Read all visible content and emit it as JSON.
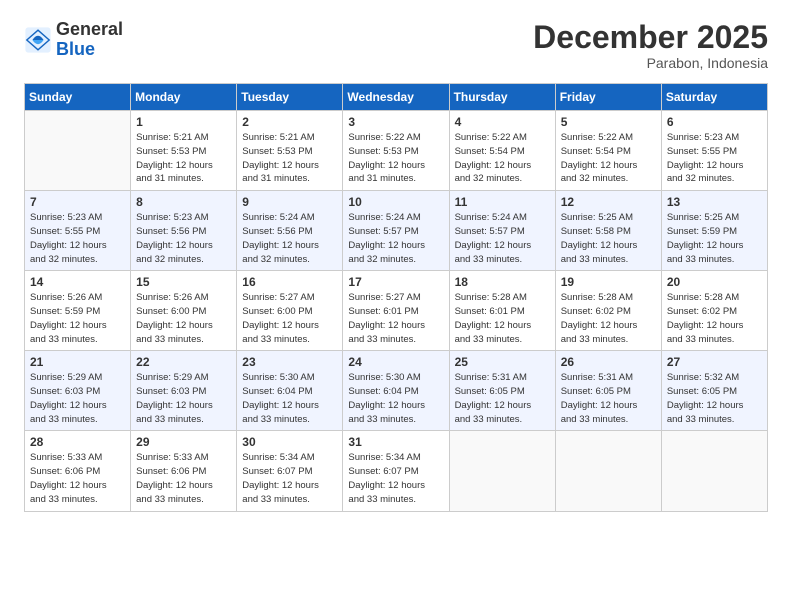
{
  "logo": {
    "general": "General",
    "blue": "Blue"
  },
  "title": "December 2025",
  "location": "Parabon, Indonesia",
  "weekdays": [
    "Sunday",
    "Monday",
    "Tuesday",
    "Wednesday",
    "Thursday",
    "Friday",
    "Saturday"
  ],
  "weeks": [
    [
      {
        "day": "",
        "info": ""
      },
      {
        "day": "1",
        "info": "Sunrise: 5:21 AM\nSunset: 5:53 PM\nDaylight: 12 hours\nand 31 minutes."
      },
      {
        "day": "2",
        "info": "Sunrise: 5:21 AM\nSunset: 5:53 PM\nDaylight: 12 hours\nand 31 minutes."
      },
      {
        "day": "3",
        "info": "Sunrise: 5:22 AM\nSunset: 5:53 PM\nDaylight: 12 hours\nand 31 minutes."
      },
      {
        "day": "4",
        "info": "Sunrise: 5:22 AM\nSunset: 5:54 PM\nDaylight: 12 hours\nand 32 minutes."
      },
      {
        "day": "5",
        "info": "Sunrise: 5:22 AM\nSunset: 5:54 PM\nDaylight: 12 hours\nand 32 minutes."
      },
      {
        "day": "6",
        "info": "Sunrise: 5:23 AM\nSunset: 5:55 PM\nDaylight: 12 hours\nand 32 minutes."
      }
    ],
    [
      {
        "day": "7",
        "info": "Sunrise: 5:23 AM\nSunset: 5:55 PM\nDaylight: 12 hours\nand 32 minutes."
      },
      {
        "day": "8",
        "info": "Sunrise: 5:23 AM\nSunset: 5:56 PM\nDaylight: 12 hours\nand 32 minutes."
      },
      {
        "day": "9",
        "info": "Sunrise: 5:24 AM\nSunset: 5:56 PM\nDaylight: 12 hours\nand 32 minutes."
      },
      {
        "day": "10",
        "info": "Sunrise: 5:24 AM\nSunset: 5:57 PM\nDaylight: 12 hours\nand 32 minutes."
      },
      {
        "day": "11",
        "info": "Sunrise: 5:24 AM\nSunset: 5:57 PM\nDaylight: 12 hours\nand 33 minutes."
      },
      {
        "day": "12",
        "info": "Sunrise: 5:25 AM\nSunset: 5:58 PM\nDaylight: 12 hours\nand 33 minutes."
      },
      {
        "day": "13",
        "info": "Sunrise: 5:25 AM\nSunset: 5:59 PM\nDaylight: 12 hours\nand 33 minutes."
      }
    ],
    [
      {
        "day": "14",
        "info": "Sunrise: 5:26 AM\nSunset: 5:59 PM\nDaylight: 12 hours\nand 33 minutes."
      },
      {
        "day": "15",
        "info": "Sunrise: 5:26 AM\nSunset: 6:00 PM\nDaylight: 12 hours\nand 33 minutes."
      },
      {
        "day": "16",
        "info": "Sunrise: 5:27 AM\nSunset: 6:00 PM\nDaylight: 12 hours\nand 33 minutes."
      },
      {
        "day": "17",
        "info": "Sunrise: 5:27 AM\nSunset: 6:01 PM\nDaylight: 12 hours\nand 33 minutes."
      },
      {
        "day": "18",
        "info": "Sunrise: 5:28 AM\nSunset: 6:01 PM\nDaylight: 12 hours\nand 33 minutes."
      },
      {
        "day": "19",
        "info": "Sunrise: 5:28 AM\nSunset: 6:02 PM\nDaylight: 12 hours\nand 33 minutes."
      },
      {
        "day": "20",
        "info": "Sunrise: 5:28 AM\nSunset: 6:02 PM\nDaylight: 12 hours\nand 33 minutes."
      }
    ],
    [
      {
        "day": "21",
        "info": "Sunrise: 5:29 AM\nSunset: 6:03 PM\nDaylight: 12 hours\nand 33 minutes."
      },
      {
        "day": "22",
        "info": "Sunrise: 5:29 AM\nSunset: 6:03 PM\nDaylight: 12 hours\nand 33 minutes."
      },
      {
        "day": "23",
        "info": "Sunrise: 5:30 AM\nSunset: 6:04 PM\nDaylight: 12 hours\nand 33 minutes."
      },
      {
        "day": "24",
        "info": "Sunrise: 5:30 AM\nSunset: 6:04 PM\nDaylight: 12 hours\nand 33 minutes."
      },
      {
        "day": "25",
        "info": "Sunrise: 5:31 AM\nSunset: 6:05 PM\nDaylight: 12 hours\nand 33 minutes."
      },
      {
        "day": "26",
        "info": "Sunrise: 5:31 AM\nSunset: 6:05 PM\nDaylight: 12 hours\nand 33 minutes."
      },
      {
        "day": "27",
        "info": "Sunrise: 5:32 AM\nSunset: 6:05 PM\nDaylight: 12 hours\nand 33 minutes."
      }
    ],
    [
      {
        "day": "28",
        "info": "Sunrise: 5:33 AM\nSunset: 6:06 PM\nDaylight: 12 hours\nand 33 minutes."
      },
      {
        "day": "29",
        "info": "Sunrise: 5:33 AM\nSunset: 6:06 PM\nDaylight: 12 hours\nand 33 minutes."
      },
      {
        "day": "30",
        "info": "Sunrise: 5:34 AM\nSunset: 6:07 PM\nDaylight: 12 hours\nand 33 minutes."
      },
      {
        "day": "31",
        "info": "Sunrise: 5:34 AM\nSunset: 6:07 PM\nDaylight: 12 hours\nand 33 minutes."
      },
      {
        "day": "",
        "info": ""
      },
      {
        "day": "",
        "info": ""
      },
      {
        "day": "",
        "info": ""
      }
    ]
  ]
}
